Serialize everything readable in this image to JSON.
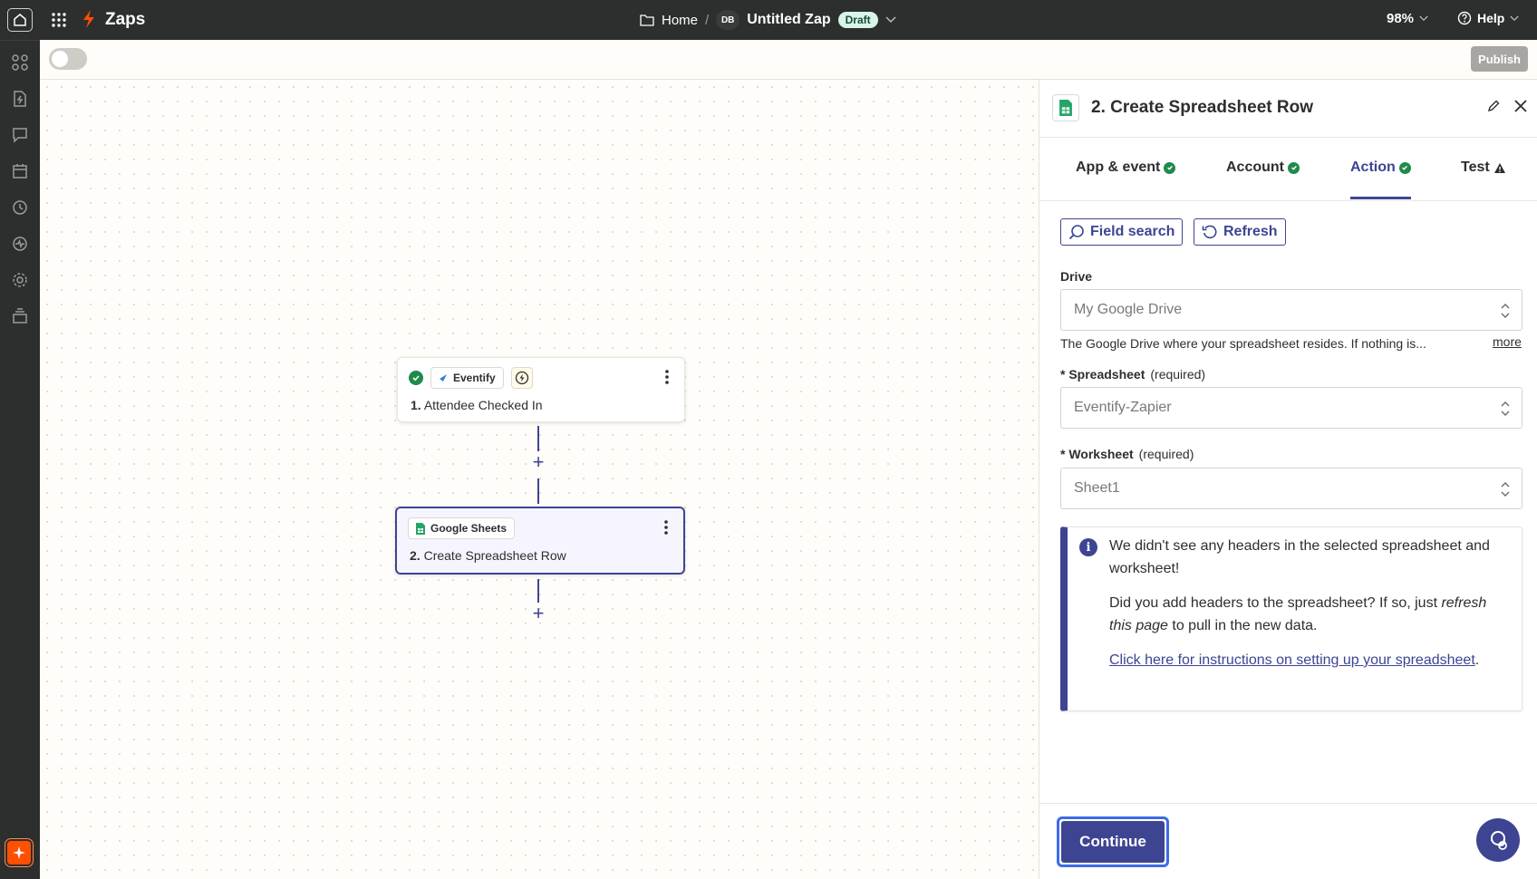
{
  "topbar": {
    "title": "Zaps",
    "breadcrumb_home": "Home",
    "breadcrumb_sep": "/",
    "avatar_initials": "DB",
    "zap_name": "Untitled Zap",
    "status_badge": "Draft",
    "zoom": "98%",
    "help_label": "Help"
  },
  "toolbar": {
    "publish_label": "Publish",
    "toggle_on": false
  },
  "canvas": {
    "steps": [
      {
        "app": "Eventify",
        "number": "1.",
        "title": "Attendee Checked In"
      },
      {
        "app": "Google Sheets",
        "number": "2.",
        "title": "Create Spreadsheet Row"
      }
    ],
    "add_step_glyph": "+"
  },
  "panel": {
    "title": "2. Create Spreadsheet Row",
    "tabs": [
      {
        "label": "App & event",
        "status": "ok"
      },
      {
        "label": "Account",
        "status": "ok"
      },
      {
        "label": "Action",
        "status": "ok",
        "active": true
      },
      {
        "label": "Test",
        "status": "warning"
      }
    ],
    "field_search_label": "Field search",
    "refresh_label": "Refresh",
    "drive": {
      "label": "Drive",
      "value": "My Google Drive",
      "help": "The Google Drive where your spreadsheet resides. If nothing is...",
      "more_label": "more"
    },
    "spreadsheet": {
      "label": "* Spreadsheet",
      "required": "(required)",
      "value": "Eventify-Zapier"
    },
    "worksheet": {
      "label": "* Worksheet",
      "required": "(required)",
      "value": "Sheet1"
    },
    "alert": {
      "line1": "We didn't see any headers in the selected spreadsheet and worksheet!",
      "line2_prefix": "Did you add headers to the spreadsheet? If so, just ",
      "line2_em": "refresh this page",
      "line2_suffix": " to pull in the new data.",
      "link_text": "Click here for instructions on setting up your spreadsheet",
      "link_suffix": "."
    },
    "continue_label": "Continue"
  },
  "colors": {
    "topbar_bg": "#2d2e2e",
    "accent": "#3d4592",
    "zap_orange": "#ff4f00",
    "success": "#1f8a4c",
    "sheets_green": "#23a566"
  }
}
